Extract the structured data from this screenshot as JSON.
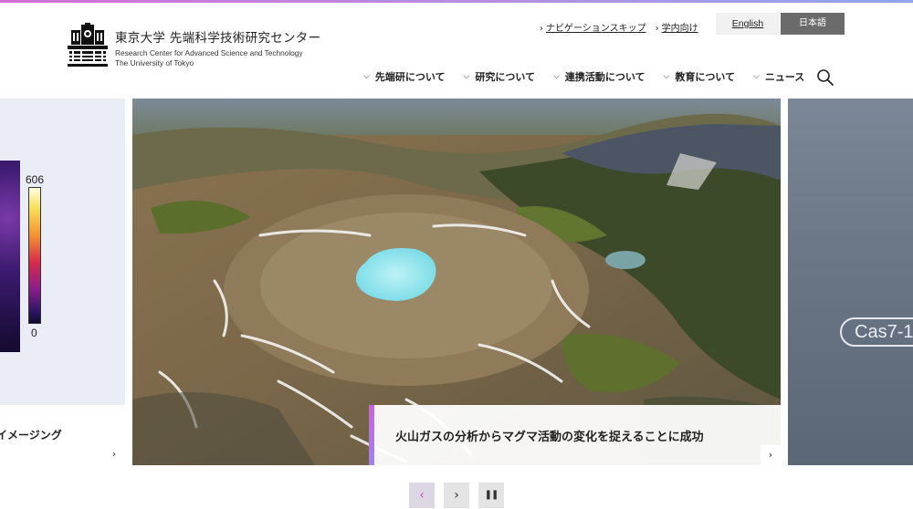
{
  "header": {
    "logo_jp": "東京大学 先端科学技術研究センター",
    "logo_en_1": "Research Center for Advanced Science and Technology",
    "logo_en_2": "The University of Tokyo",
    "util_links": [
      "ナビゲーションスキップ",
      "学内向け"
    ],
    "lang_en": "English",
    "lang_jp": "日本語",
    "nav": [
      "先端研について",
      "研究について",
      "連携活動について",
      "教育について",
      "ニュース"
    ],
    "icons": {
      "search": "search-icon",
      "nav_caret": "chevron-down-icon"
    }
  },
  "carousel": {
    "left_slide": {
      "caption": "イメージング",
      "colorbar_max": "606",
      "colorbar_min": "0",
      "more_icon": "chevron-right-icon"
    },
    "main_slide": {
      "caption": "火山ガスの分析からマグマ活動の変化を捉えることに成功",
      "more_icon": "chevron-right-icon"
    },
    "right_slide": {
      "label": "Cas7-1"
    },
    "controls": {
      "prev": "‹",
      "next": "›",
      "pause": "❚❚"
    }
  },
  "colors": {
    "accent_gradient_start": "#d16fd3",
    "accent_gradient_end": "#8fa6ef",
    "lang_active_bg": "#6b6b6b"
  }
}
